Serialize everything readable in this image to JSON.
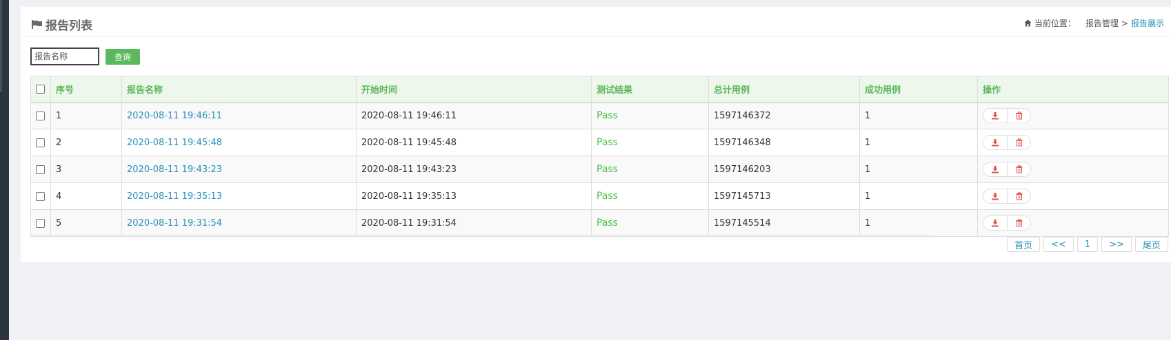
{
  "header": {
    "title": "报告列表",
    "breadcrumb": {
      "label": "当前位置：",
      "parent": "报告管理",
      "separator": ">",
      "current": "报告展示"
    }
  },
  "search": {
    "placeholder": "报告名称",
    "value": "",
    "button": "查询"
  },
  "table": {
    "columns": [
      "序号",
      "报告名称",
      "开始时间",
      "测试结果",
      "总计用例",
      "成功用例",
      "操作"
    ],
    "rows": [
      {
        "index": "1",
        "name": "2020-08-11 19:46:11",
        "start": "2020-08-11 19:46:11",
        "result": "Pass",
        "total": "1597146372",
        "success": "1"
      },
      {
        "index": "2",
        "name": "2020-08-11 19:45:48",
        "start": "2020-08-11 19:45:48",
        "result": "Pass",
        "total": "1597146348",
        "success": "1"
      },
      {
        "index": "3",
        "name": "2020-08-11 19:43:23",
        "start": "2020-08-11 19:43:23",
        "result": "Pass",
        "total": "1597146203",
        "success": "1"
      },
      {
        "index": "4",
        "name": "2020-08-11 19:35:13",
        "start": "2020-08-11 19:35:13",
        "result": "Pass",
        "total": "1597145713",
        "success": "1"
      },
      {
        "index": "5",
        "name": "2020-08-11 19:31:54",
        "start": "2020-08-11 19:31:54",
        "result": "Pass",
        "total": "1597145514",
        "success": "1"
      }
    ],
    "actions": [
      "download-icon",
      "trash-icon"
    ]
  },
  "pagination": {
    "first": "首页",
    "prev": "<<",
    "page": "1",
    "next": ">>",
    "last": "尾页"
  },
  "colors": {
    "accent_green": "#5cb85c",
    "link_blue": "#2a8fbd",
    "danger_red": "#d9534f",
    "header_bg": "#edf7ec"
  }
}
